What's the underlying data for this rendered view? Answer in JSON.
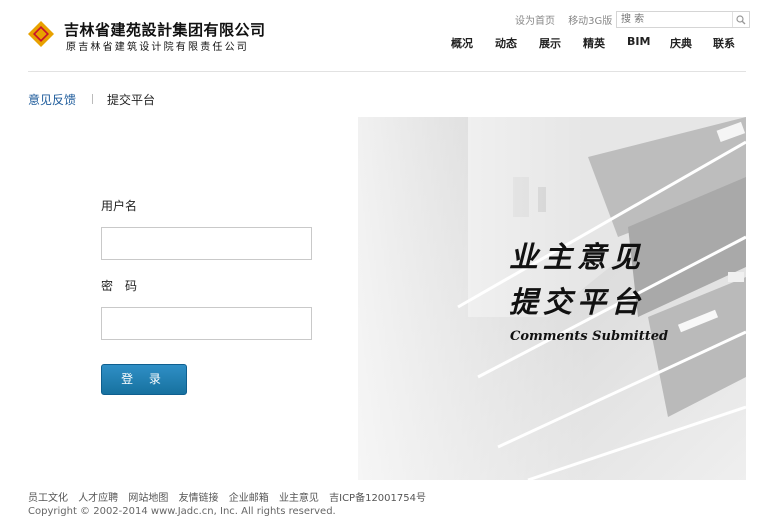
{
  "brand": {
    "name": "吉林省建苑設計集团有限公司",
    "sub": "原吉林省建筑设计院有限责任公司",
    "colors": {
      "primary": "#e8a100",
      "secondary": "#c8102e"
    }
  },
  "top_links": {
    "home": "设为首页",
    "mobile": "移动3G版"
  },
  "search": {
    "placeholder": "搜 索",
    "icon": "search-icon"
  },
  "nav": [
    {
      "label": "概况"
    },
    {
      "label": "动态"
    },
    {
      "label": "展示"
    },
    {
      "label": "精英"
    },
    {
      "label": "BIM"
    },
    {
      "label": "庆典"
    },
    {
      "label": "联系"
    }
  ],
  "subhead": {
    "active": "意见反馈",
    "second": "提交平台",
    "active_color": "#1c5a9a"
  },
  "form": {
    "username_label": "用户名",
    "password_label": "密　码",
    "username_value": "",
    "password_value": "",
    "login_label": "登 录"
  },
  "slogan": {
    "line1": "业主意见",
    "line2": "提交平台",
    "english": "Comments Submitted"
  },
  "footer": {
    "links": [
      "员工文化",
      "人才应聘",
      "网站地图",
      "友情链接",
      "企业邮箱",
      "业主意见",
      "吉ICP备12001754号"
    ],
    "copyright": "Copyright © 2002-2014 www.Jadc.cn, Inc. All rights reserved."
  }
}
